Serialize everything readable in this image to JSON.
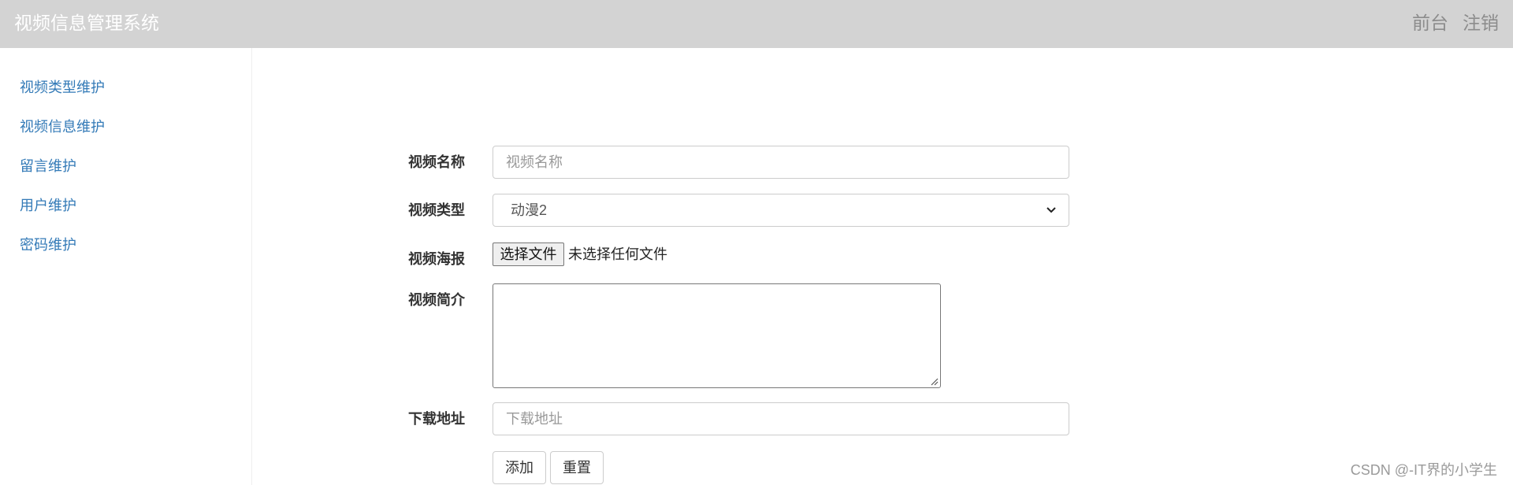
{
  "header": {
    "title": "视频信息管理系统",
    "nav": [
      "前台",
      "注销"
    ]
  },
  "sidebar": {
    "items": [
      "视频类型维护",
      "视频信息维护",
      "留言维护",
      "用户维护",
      "密码维护"
    ]
  },
  "form": {
    "name_label": "视频名称",
    "name_placeholder": "视频名称",
    "type_label": "视频类型",
    "type_selected": "动漫2",
    "poster_label": "视频海报",
    "file_button": "选择文件",
    "file_status": "未选择任何文件",
    "intro_label": "视频简介",
    "download_label": "下载地址",
    "download_placeholder": "下载地址",
    "add_button": "添加",
    "reset_button": "重置"
  },
  "watermark": "CSDN @-IT界的小学生",
  "colors": {
    "topbar": "#d3d3d3",
    "link": "#337ab7"
  }
}
